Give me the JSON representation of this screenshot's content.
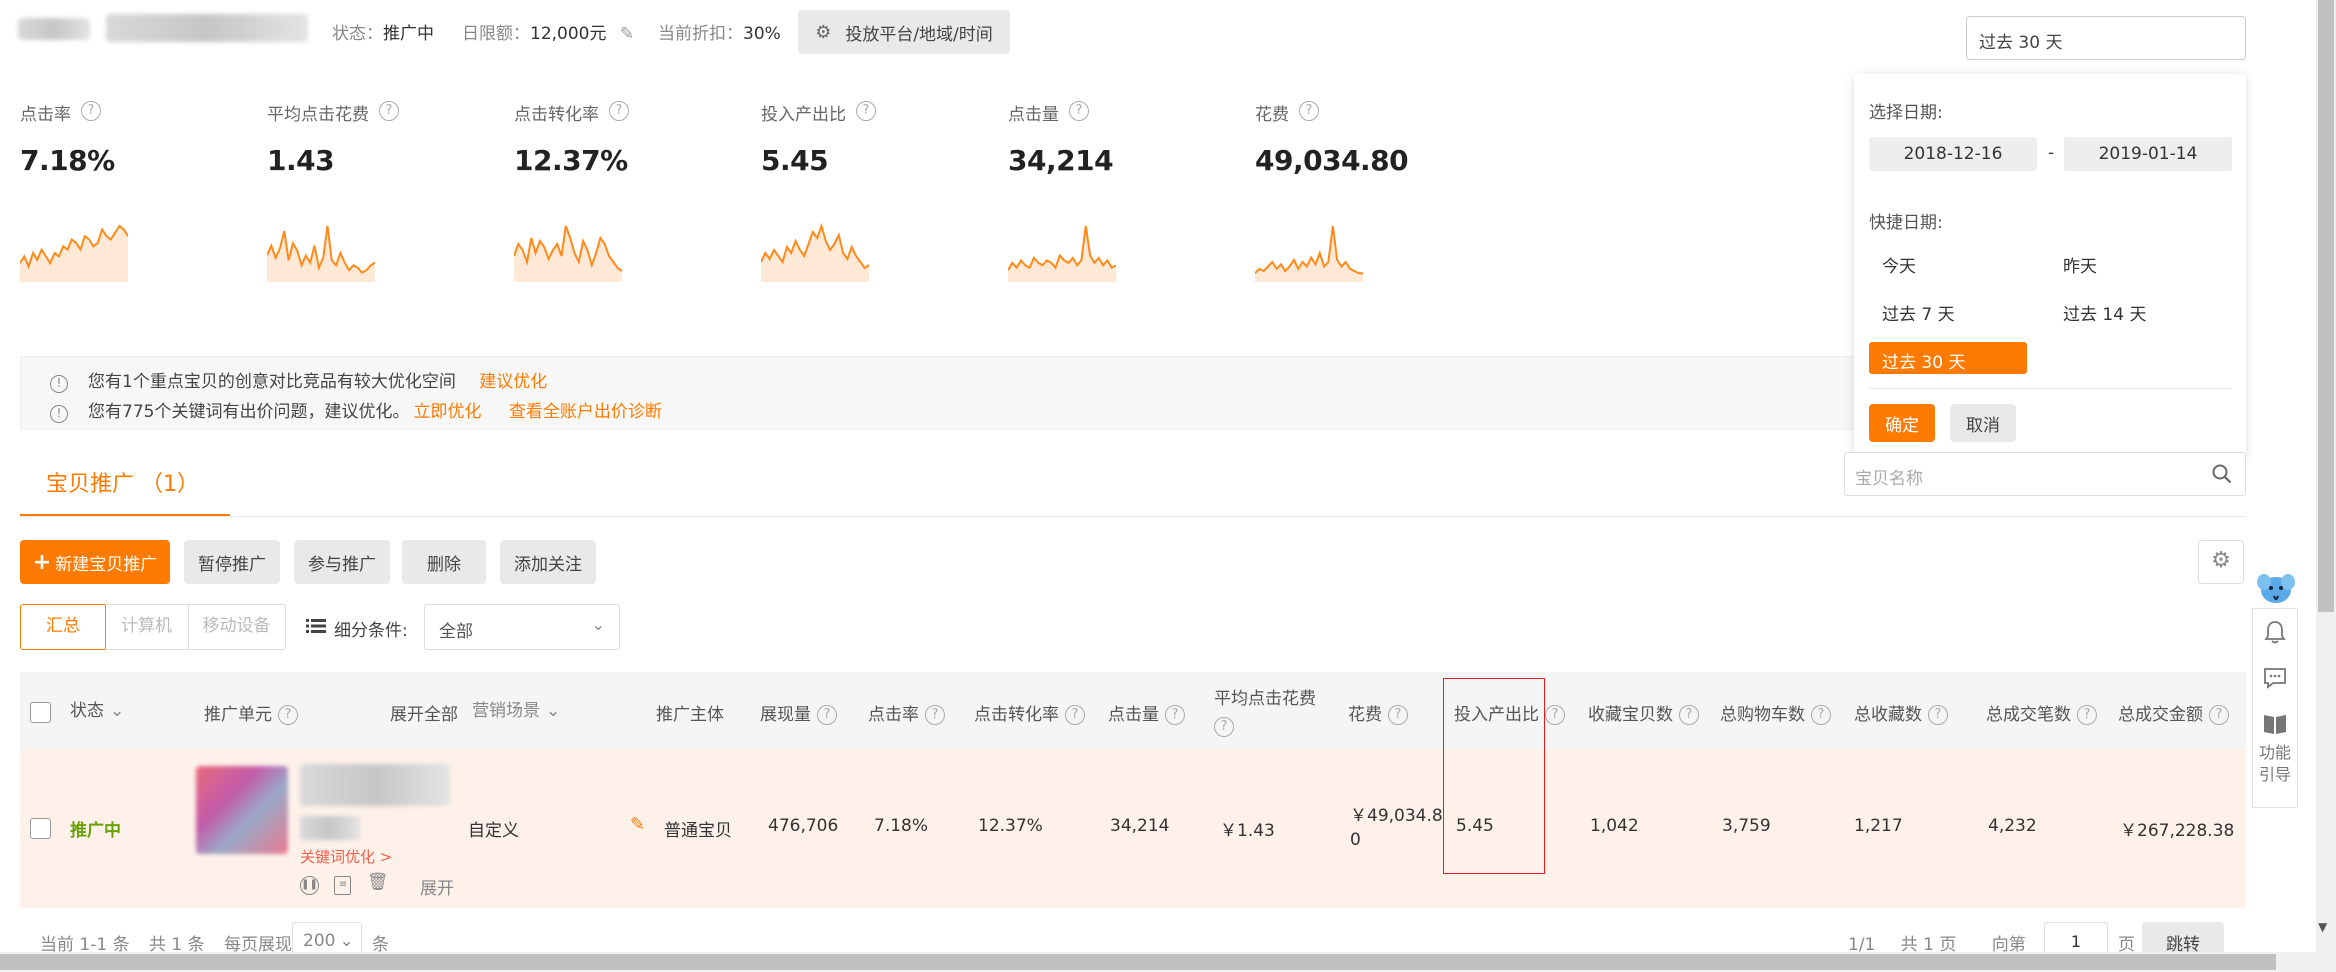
{
  "header": {
    "status_label": "状态：",
    "status_value": "推广中",
    "daily_limit_label": "日限额：",
    "daily_limit_value": "12,000元",
    "discount_label": "当前折扣：",
    "discount_value": "30%",
    "platform_button": "投放平台/地域/时间",
    "date_range_value": "过去 30 天"
  },
  "metrics": [
    {
      "label": "点击率",
      "value": "7.18%"
    },
    {
      "label": "平均点击花费",
      "value": "1.43"
    },
    {
      "label": "点击转化率",
      "value": "12.37%"
    },
    {
      "label": "投入产出比",
      "value": "5.45"
    },
    {
      "label": "点击量",
      "value": "34,214"
    },
    {
      "label": "花费",
      "value": "49,034.80"
    }
  ],
  "notices": {
    "line1_text": "您有1个重点宝贝的创意对比竞品有较大优化空间",
    "line1_link": "建议优化",
    "line2_text": "您有775个关键词有出价问题，建议优化。",
    "line2_link1": "立即优化",
    "line2_link2": "查看全账户出价诊断"
  },
  "date_picker": {
    "select_label": "选择日期:",
    "start_date": "2018-12-16",
    "separator": "-",
    "end_date": "2019-01-14",
    "quick_label": "快捷日期:",
    "options": [
      "今天",
      "昨天",
      "过去 7 天",
      "过去 14 天",
      "过去 30 天"
    ],
    "selected": "过去 30 天",
    "confirm": "确定",
    "cancel": "取消"
  },
  "tabs": {
    "active_tab": "宝贝推广 （1）",
    "search_placeholder": "宝贝名称"
  },
  "toolbar": {
    "new_item": "新建宝贝推广",
    "pause": "暂停推广",
    "join": "参与推广",
    "delete": "删除",
    "follow": "添加关注"
  },
  "filter": {
    "tab_summary": "汇总",
    "tab_pc": "计算机",
    "tab_mobile": "移动设备",
    "condition_label": "细分条件:",
    "condition_value": "全部"
  },
  "table": {
    "headers": {
      "status": "状态",
      "unit": "推广单元",
      "expand_all": "展开全部",
      "scene": "营销场景",
      "subject": "推广主体",
      "impressions": "展现量",
      "ctr": "点击率",
      "cvr": "点击转化率",
      "clicks": "点击量",
      "avg_cpc": "平均点击花费",
      "cost": "花费",
      "roi": "投入产出比",
      "fav_items": "收藏宝贝数",
      "carts": "总购物车数",
      "favs": "总收藏数",
      "orders": "总成交笔数",
      "gmv": "总成交金额"
    },
    "row": {
      "status": "推广中",
      "scene": "自定义",
      "subject": "普通宝贝",
      "impressions": "476,706",
      "ctr": "7.18%",
      "cvr": "12.37%",
      "clicks": "34,214",
      "avg_cpc": "￥1.43",
      "cost_line1": "￥49,034.8",
      "cost_line2": "0",
      "roi": "5.45",
      "fav_items": "1,042",
      "carts": "3,759",
      "favs": "1,217",
      "orders": "4,232",
      "gmv": "￥267,228.38",
      "keyword_hint": "关键词优化 >",
      "expand": "展开"
    }
  },
  "pagination": {
    "current": "当前 1-1 条",
    "total": "共 1 条",
    "per_page": "每页展现",
    "per_page_value": "200",
    "unit": "条",
    "page_info": "1/1",
    "total_pages": "共 1 页",
    "goto": "向第",
    "goto_value": "1",
    "page_suffix": "页",
    "jump": "跳转"
  },
  "side_tools": {
    "guide_line1": "功能",
    "guide_line2": "引导"
  },
  "colors": {
    "accent": "#ff7a00",
    "row_bg": "#fdf1ea",
    "header_bg": "#f5f5f5",
    "status_green": "#6aa106",
    "roi_box": "#e02020"
  },
  "sparklines": [
    [
      5,
      7,
      4,
      8,
      6,
      9,
      7,
      5,
      8,
      7,
      10,
      9,
      12,
      11,
      9,
      13,
      12,
      10,
      11,
      15,
      13,
      12,
      14,
      16,
      15,
      13
    ],
    [
      10,
      14,
      9,
      13,
      20,
      8,
      15,
      12,
      6,
      10,
      7,
      14,
      5,
      9,
      22,
      8,
      6,
      11,
      7,
      4,
      6,
      5,
      3,
      4,
      6,
      7
    ],
    [
      8,
      12,
      10,
      6,
      14,
      9,
      13,
      11,
      7,
      10,
      12,
      8,
      18,
      14,
      9,
      6,
      13,
      10,
      5,
      9,
      14,
      12,
      8,
      6,
      4,
      3
    ],
    [
      6,
      9,
      7,
      10,
      8,
      6,
      11,
      9,
      13,
      10,
      8,
      12,
      16,
      14,
      18,
      13,
      10,
      12,
      15,
      9,
      7,
      11,
      8,
      6,
      4,
      5
    ],
    [
      4,
      7,
      5,
      8,
      6,
      5,
      9,
      7,
      6,
      8,
      7,
      5,
      10,
      8,
      7,
      9,
      6,
      8,
      22,
      10,
      7,
      9,
      6,
      8,
      5,
      6
    ],
    [
      3,
      5,
      4,
      6,
      8,
      5,
      7,
      4,
      6,
      9,
      5,
      8,
      6,
      10,
      7,
      12,
      6,
      8,
      24,
      9,
      6,
      8,
      5,
      4,
      3,
      3
    ]
  ]
}
